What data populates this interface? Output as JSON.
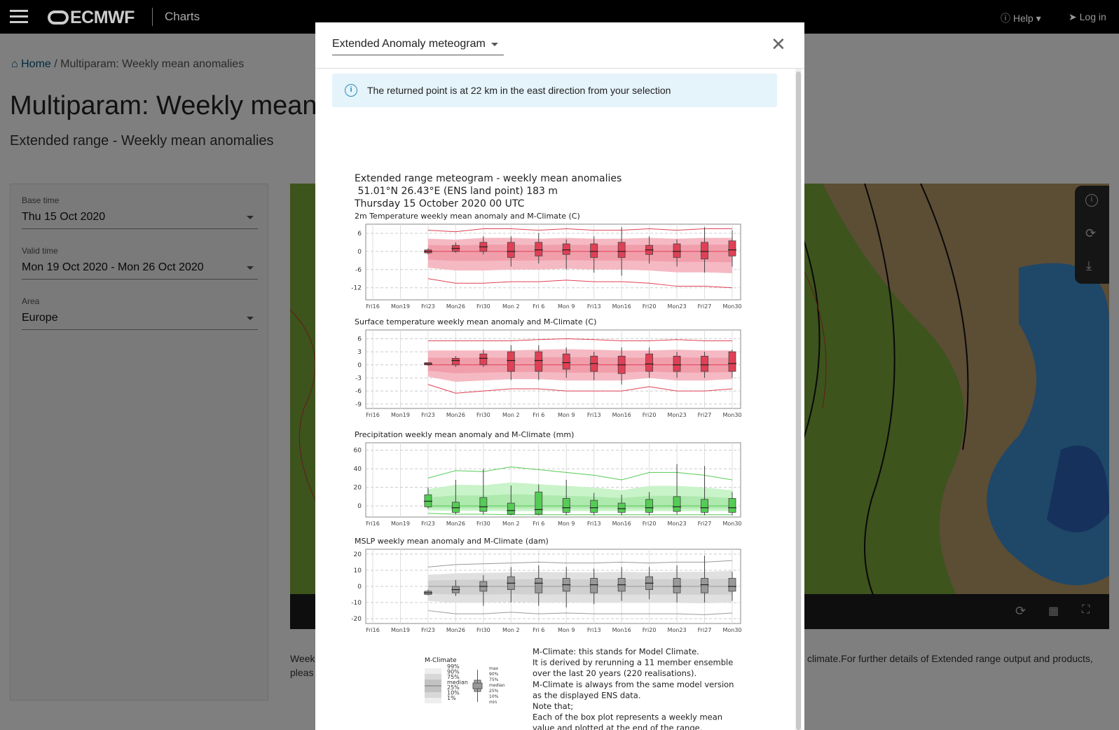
{
  "topbar": {
    "brand": "ECMWF",
    "title": "Charts",
    "help": "Help",
    "login": "Log in"
  },
  "breadcrumb": {
    "home": "Home",
    "separator": "/",
    "current": "Multiparam: Weekly mean anomalies"
  },
  "page": {
    "title": "Multiparam: Weekly mean a",
    "subtitle": "Extended range - Weekly mean anomalies"
  },
  "filters": {
    "base_time": {
      "label": "Base time",
      "value": "Thu 15 Oct 2020"
    },
    "valid_time": {
      "label": "Valid time",
      "value": "Mon 19 Oct 2020 - Mon 26 Oct 2020"
    },
    "area": {
      "label": "Area",
      "value": "Europe"
    }
  },
  "description": {
    "line1_left": "Week",
    "line1_right": "climate.For further details of Extended range output and products,",
    "line2_left": "pleas"
  },
  "modal": {
    "selected_product": "Extended Anomaly meteogram",
    "info": "The returned point is at 22 km in the east direction from your selection"
  },
  "meteogram": {
    "title": "Extended range meteogram - weekly mean anomalies",
    "location": " 51.01°N 26.43°E (ENS land point) 183 m",
    "date": "Thursday 15 October 2020 00 UTC",
    "x_ticks": [
      "Fri16",
      "Mon19",
      "Fri23",
      "Mon26",
      "Fri30",
      "Mon 2",
      "Fri 6",
      "Mon 9",
      "Fri13",
      "Mon16",
      "Fri20",
      "Mon23",
      "Fri27",
      "Mon30"
    ],
    "colors": {
      "temp": "#e04055",
      "temp_band1": "#f5b9c3",
      "temp_band2": "#ee8c9b",
      "precip": "#55cc55",
      "precip_band1": "#c9f3c9",
      "precip_band2": "#9de39d",
      "mslp": "#999999",
      "mslp_band1": "#e0e0e0",
      "mslp_band2": "#c4c4c4"
    },
    "legend": {
      "title": "M-Climate",
      "left_labels": [
        "99%",
        "90%",
        "75%",
        "median",
        "25%",
        "10%",
        "1%"
      ],
      "right_labels": [
        "max",
        "90%",
        "75%",
        "median",
        "25%",
        "10%",
        "min"
      ]
    },
    "notes": [
      "M-Climate: this stands for Model Climate.",
      "It is derived by rerunning a 11 member ensemble",
      "over the last 20 years  (220 realisations).",
      "M-Climate is always from the same model version",
      "as the displayed ENS data.",
      "Note that;",
      "Each of the box plot represents a weekly mean",
      "value and plotted at the end of the range."
    ]
  },
  "chart_data": [
    {
      "type": "box",
      "title": "2m Temperature weekly mean anomaly and M-Climate (C)",
      "x": [
        "Fri16",
        "Mon19",
        "Fri23",
        "Mon26",
        "Fri30",
        "Mon 2",
        "Fri 6",
        "Mon 9",
        "Fri13",
        "Mon16",
        "Fri20",
        "Mon23",
        "Fri27",
        "Mon30"
      ],
      "y_ticks": [
        6,
        0,
        -6,
        -12
      ],
      "ylim": [
        -16,
        9
      ],
      "median": [
        null,
        null,
        0,
        1,
        1.5,
        0,
        0.5,
        0.5,
        0,
        0,
        0.5,
        0,
        0,
        0.5
      ],
      "box_low": [
        null,
        null,
        -0.5,
        0,
        0,
        -2,
        -1.5,
        -1,
        -2,
        -2,
        -1,
        -2,
        -2.5,
        -1.5
      ],
      "box_high": [
        null,
        null,
        0.5,
        2,
        3,
        3,
        3,
        2.5,
        2.5,
        3,
        2,
        2.5,
        3,
        3.5
      ],
      "whisk_low": [
        null,
        null,
        -1,
        -0.5,
        -1,
        -5,
        -4,
        -6,
        -7,
        -8,
        -4,
        -5,
        -7,
        -5
      ],
      "whisk_high": [
        null,
        null,
        1,
        3,
        5,
        5,
        6,
        4,
        5,
        8,
        5,
        4,
        8,
        7
      ],
      "clim_p1": [
        null,
        null,
        -9,
        -10.5,
        -10.5,
        -10,
        -10,
        -9.5,
        -10,
        -10,
        -10.5,
        -11.5,
        -11.5,
        -12
      ],
      "clim_p99": [
        null,
        null,
        7,
        6.5,
        7.5,
        7.5,
        7,
        7.5,
        7,
        7,
        7.5,
        7,
        7.5,
        7.5
      ]
    },
    {
      "type": "box",
      "title": "Surface temperature weekly mean anomaly and M-Climate (C)",
      "x": [
        "Fri16",
        "Mon19",
        "Fri23",
        "Mon26",
        "Fri30",
        "Mon 2",
        "Fri 6",
        "Mon 9",
        "Fri13",
        "Mon16",
        "Fri20",
        "Mon23",
        "Fri27",
        "Mon30"
      ],
      "y_ticks": [
        6,
        3,
        0,
        -3,
        -6,
        -9
      ],
      "ylim": [
        -10,
        8
      ],
      "median": [
        null,
        null,
        0.2,
        1,
        1.5,
        1,
        1,
        0.5,
        0.3,
        0,
        0.2,
        0,
        0,
        0.3
      ],
      "box_low": [
        null,
        null,
        0,
        0,
        0,
        -1.5,
        -1.5,
        -1,
        -1.5,
        -2,
        -1.5,
        -1.5,
        -1.5,
        -1.5
      ],
      "box_high": [
        null,
        null,
        0.5,
        1.5,
        2.5,
        3,
        3,
        2.5,
        2,
        2,
        2.5,
        2,
        2,
        3
      ],
      "whisk_low": [
        null,
        null,
        -0.2,
        -0.5,
        -0.5,
        -3.5,
        -3.5,
        -3,
        -3.5,
        -4.5,
        -3,
        -3,
        -3,
        -3
      ],
      "whisk_high": [
        null,
        null,
        0.6,
        2,
        3.5,
        4.5,
        4.5,
        4,
        3,
        4,
        4,
        3,
        3,
        3.5
      ],
      "clim_p1": [
        null,
        null,
        -4.5,
        -6.5,
        -6,
        -5.5,
        -5.5,
        -6,
        -6,
        -6,
        -5,
        -6,
        -6,
        -5.5
      ],
      "clim_p99": [
        null,
        null,
        5.5,
        5.5,
        5.5,
        5.5,
        5.8,
        6,
        5.8,
        5.5,
        5.5,
        5.8,
        5.5,
        5.5
      ]
    },
    {
      "type": "box",
      "title": "Precipitation weekly mean anomaly and M-Climate (mm)",
      "x": [
        "Fri16",
        "Mon19",
        "Fri23",
        "Mon26",
        "Fri30",
        "Mon 2",
        "Fri 6",
        "Mon 9",
        "Fri13",
        "Mon16",
        "Fri20",
        "Mon23",
        "Fri27",
        "Mon30"
      ],
      "y_ticks": [
        60,
        40,
        20,
        0
      ],
      "ylim": [
        -12,
        68
      ],
      "median": [
        null,
        null,
        5,
        -2,
        -1,
        -5,
        -4,
        -2,
        -2,
        -3,
        -2,
        -1,
        -2,
        -2
      ],
      "box_low": [
        null,
        null,
        -1,
        -7,
        -6,
        -9,
        -9,
        -7,
        -7,
        -7,
        -7,
        -6,
        -7,
        -7
      ],
      "box_high": [
        null,
        null,
        12,
        4,
        9,
        3,
        15,
        8,
        6,
        3,
        7,
        10,
        7,
        8
      ],
      "whisk_low": [
        null,
        null,
        -3,
        -9,
        -9,
        -10,
        -10,
        -10,
        -10,
        -10,
        -10,
        -9,
        -10,
        -10
      ],
      "whisk_high": [
        null,
        null,
        20,
        28,
        40,
        22,
        23,
        28,
        14,
        12,
        15,
        45,
        43,
        15
      ],
      "clim_p1": [
        null,
        null,
        -8,
        -9,
        -9,
        -9.5,
        -9.5,
        -9.5,
        -9.5,
        -9.5,
        -9.5,
        -9.5,
        -9.5,
        -9.5
      ],
      "clim_p99": [
        null,
        null,
        30,
        38,
        37,
        42,
        39,
        36,
        33,
        28,
        36,
        36,
        33,
        28
      ]
    },
    {
      "type": "box",
      "title": "MSLP weekly mean anomaly and M-Climate (dam)",
      "x": [
        "Fri16",
        "Mon19",
        "Fri23",
        "Mon26",
        "Fri30",
        "Mon 2",
        "Fri 6",
        "Mon 9",
        "Fri13",
        "Mon16",
        "Fri20",
        "Mon23",
        "Fri27",
        "Mon30"
      ],
      "y_ticks": [
        20,
        10,
        0,
        -10,
        -20
      ],
      "ylim": [
        -23,
        23
      ],
      "median": [
        null,
        null,
        -4,
        -2,
        0,
        2,
        2,
        1,
        1,
        1,
        2,
        0,
        1,
        0
      ],
      "box_low": [
        null,
        null,
        -5,
        -4,
        -3,
        -2,
        -4,
        -3,
        -4,
        -3,
        -2,
        -4,
        -4,
        -3
      ],
      "box_high": [
        null,
        null,
        -3,
        0,
        3,
        6,
        5,
        5,
        5,
        5,
        6,
        5,
        5,
        5
      ],
      "whisk_low": [
        null,
        null,
        -5.5,
        -6,
        -12,
        -10,
        -12,
        -13,
        -11,
        -9,
        -8,
        -10,
        -10,
        -9
      ],
      "whisk_high": [
        null,
        null,
        -2,
        4,
        7,
        12,
        13,
        12,
        11,
        12,
        12,
        13,
        19,
        9
      ],
      "clim_p1": [
        null,
        null,
        -15,
        -17,
        -17,
        -16,
        -17,
        -16.5,
        -17,
        -17,
        -17,
        -17,
        -17.5,
        -16.5
      ],
      "clim_p99": [
        null,
        null,
        12,
        13.5,
        14,
        14.5,
        15,
        14.5,
        14.5,
        15,
        14.5,
        15,
        15,
        16
      ]
    }
  ]
}
